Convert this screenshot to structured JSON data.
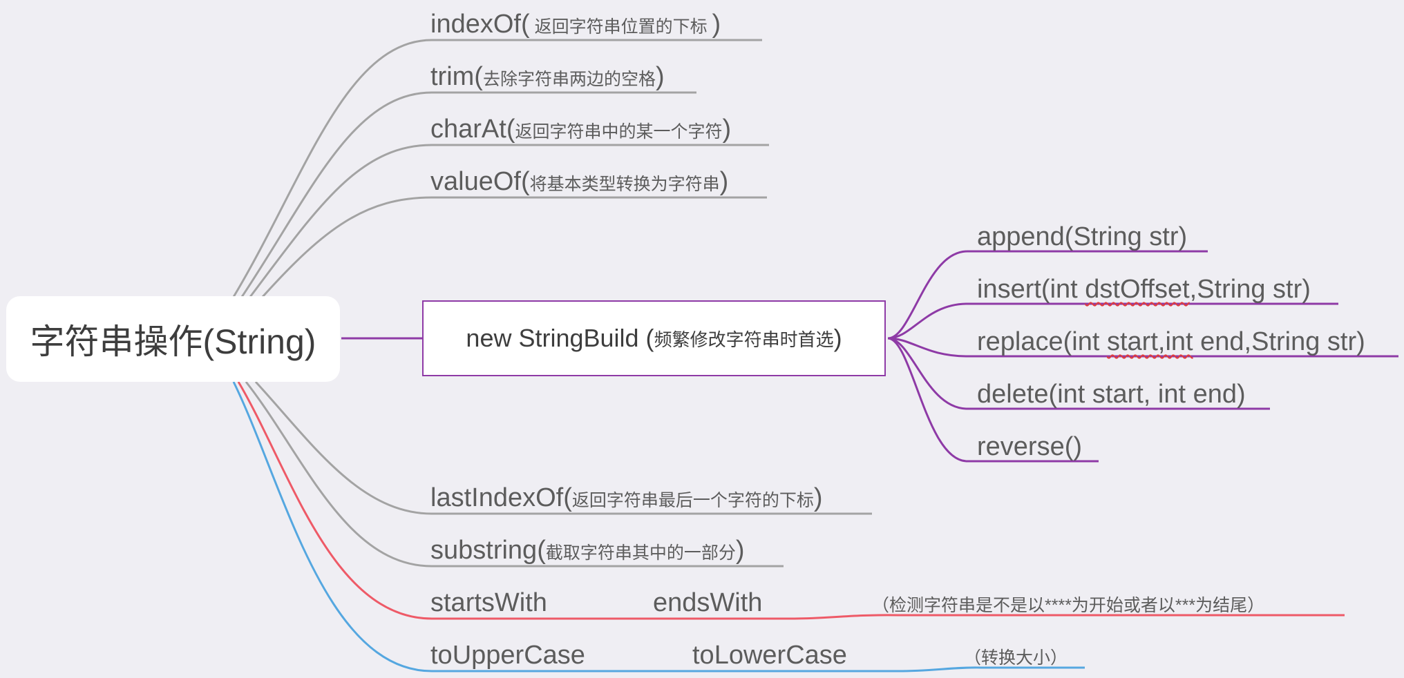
{
  "root": {
    "label": "字符串操作(String)"
  },
  "top_branches": [
    {
      "main": "indexOf(",
      "desc": " 返回字符串位置的下标 ",
      "close": ")"
    },
    {
      "main": "trim(",
      "desc": "去除字符串两边的空格",
      "close": ")"
    },
    {
      "main": "charAt(",
      "desc": "返回字符串中的某一个字符",
      "close": ")"
    },
    {
      "main": "valueOf(",
      "desc": "将基本类型转换为字符串",
      "close": ")"
    }
  ],
  "string_builder": {
    "label": "new StringBuild (",
    "desc": "频繁修改字符串时首选",
    "close": ")",
    "methods": [
      {
        "label": "append(String str)"
      },
      {
        "label_pre": "insert(int ",
        "label_sq": "dstOffset",
        "label_post": ",String str)"
      },
      {
        "label_pre": "replace(int ",
        "label_sq": "start,int",
        "label_post": " end,String str)"
      },
      {
        "label": "delete(int start, int end)"
      },
      {
        "label": "reverse()"
      }
    ]
  },
  "bottom_branches": [
    {
      "main": "lastIndexOf(",
      "desc": "返回字符串最后一个字符的下标",
      "close": ")"
    },
    {
      "main": "substring(",
      "desc": "截取字符串其中的一部分",
      "close": ")"
    }
  ],
  "starts_ends": {
    "a": "startsWith",
    "b": "endsWith",
    "desc": "（检测字符串是不是以****为开始或者以***为结尾）"
  },
  "case_convert": {
    "a": "toUpperCase",
    "b": "toLowerCase",
    "desc": "（转换大小）"
  },
  "colors": {
    "gray": "#a3a3a3",
    "purple": "#8e3aa6",
    "red": "#ee5a67",
    "blue": "#55a7e0",
    "background": "#efeef3"
  }
}
